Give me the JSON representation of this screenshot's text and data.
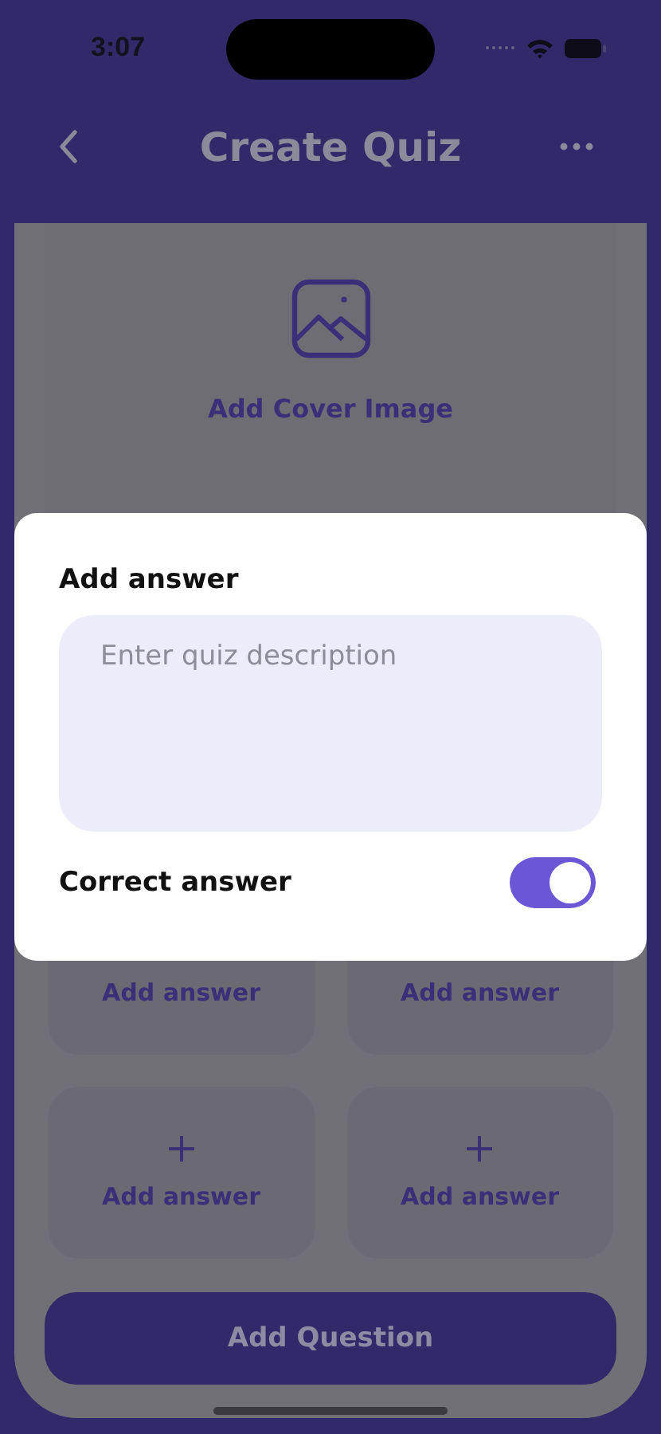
{
  "status_bar": {
    "time": "3:07"
  },
  "nav": {
    "title": "Create Quiz"
  },
  "cover": {
    "label": "Add Cover Image"
  },
  "answers": [
    {
      "label": "Add answer",
      "kind": "covered"
    },
    {
      "label": "Add answer",
      "kind": "covered"
    },
    {
      "label": "Add answer",
      "kind": "full"
    },
    {
      "label": "Add answer",
      "kind": "full"
    }
  ],
  "primary_button": {
    "label": "Add Question"
  },
  "modal": {
    "title": "Add answer",
    "field": {
      "placeholder": "Enter quiz description"
    },
    "toggle": {
      "label": "Correct answer",
      "on": true
    }
  }
}
